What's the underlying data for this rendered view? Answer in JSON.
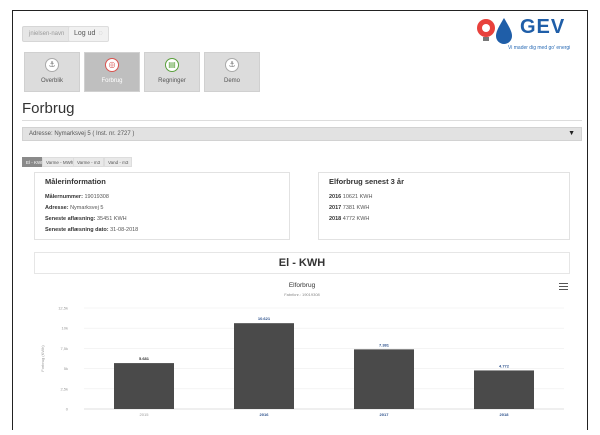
{
  "header": {
    "user_name": "jnielsen-navn",
    "logout_label": "Log ud",
    "logo_text": "GEV",
    "logo_tagline": "Vi mader dig med go' energi"
  },
  "tabs": [
    {
      "label": "Overblik",
      "icon": "anchor-icon",
      "active": false
    },
    {
      "label": "Forbrug",
      "icon": "chart-icon",
      "active": true
    },
    {
      "label": "Regninger",
      "icon": "bill-icon",
      "active": false
    },
    {
      "label": "Demo",
      "icon": "anchor-icon",
      "active": false
    }
  ],
  "page": {
    "title": "Forbrug"
  },
  "address": {
    "selected": "Adresse: Nymarksvej 5 ( Inst. nr. 2727 )"
  },
  "utility_tabs": [
    "El - KWH",
    "Varme - MWh",
    "Varme - m3",
    "Vand - m3"
  ],
  "meter_info": {
    "heading": "Målerinformation",
    "rows": [
      {
        "label": "Målernummer:",
        "value": "19019308"
      },
      {
        "label": "Adresse:",
        "value": "Nymarksvej 5"
      },
      {
        "label": "Seneste aflæsning:",
        "value": "35451 KWH"
      },
      {
        "label": "Seneste aflæsning dato:",
        "value": "31-08-2018"
      }
    ]
  },
  "consumption": {
    "heading": "Elforbrug senest 3 år",
    "rows": [
      {
        "year": "2016",
        "value": "10621 KWH"
      },
      {
        "year": "2017",
        "value": "7381 KWH"
      },
      {
        "year": "2018",
        "value": "4772 KWH"
      }
    ]
  },
  "chart_section": {
    "heading": "El - KWH"
  },
  "chart_data": {
    "type": "bar",
    "title": "Elforbrug",
    "subtitle": "Fabriknr.: 19019308",
    "ylabel": "Forbrug (KWh)",
    "categories": [
      "2015",
      "2016",
      "2017",
      "2018"
    ],
    "values": [
      5681,
      10621,
      7381,
      4772
    ],
    "data_labels": [
      "5.681",
      "10.621",
      "7.381",
      "4.772"
    ],
    "yticks": [
      "0",
      "2,5k",
      "5k",
      "7,5k",
      "10k",
      "12,5k"
    ],
    "ylim": [
      0,
      12500
    ],
    "bar_color": "#4a4a4a",
    "label_color": "#2a4f8a"
  }
}
